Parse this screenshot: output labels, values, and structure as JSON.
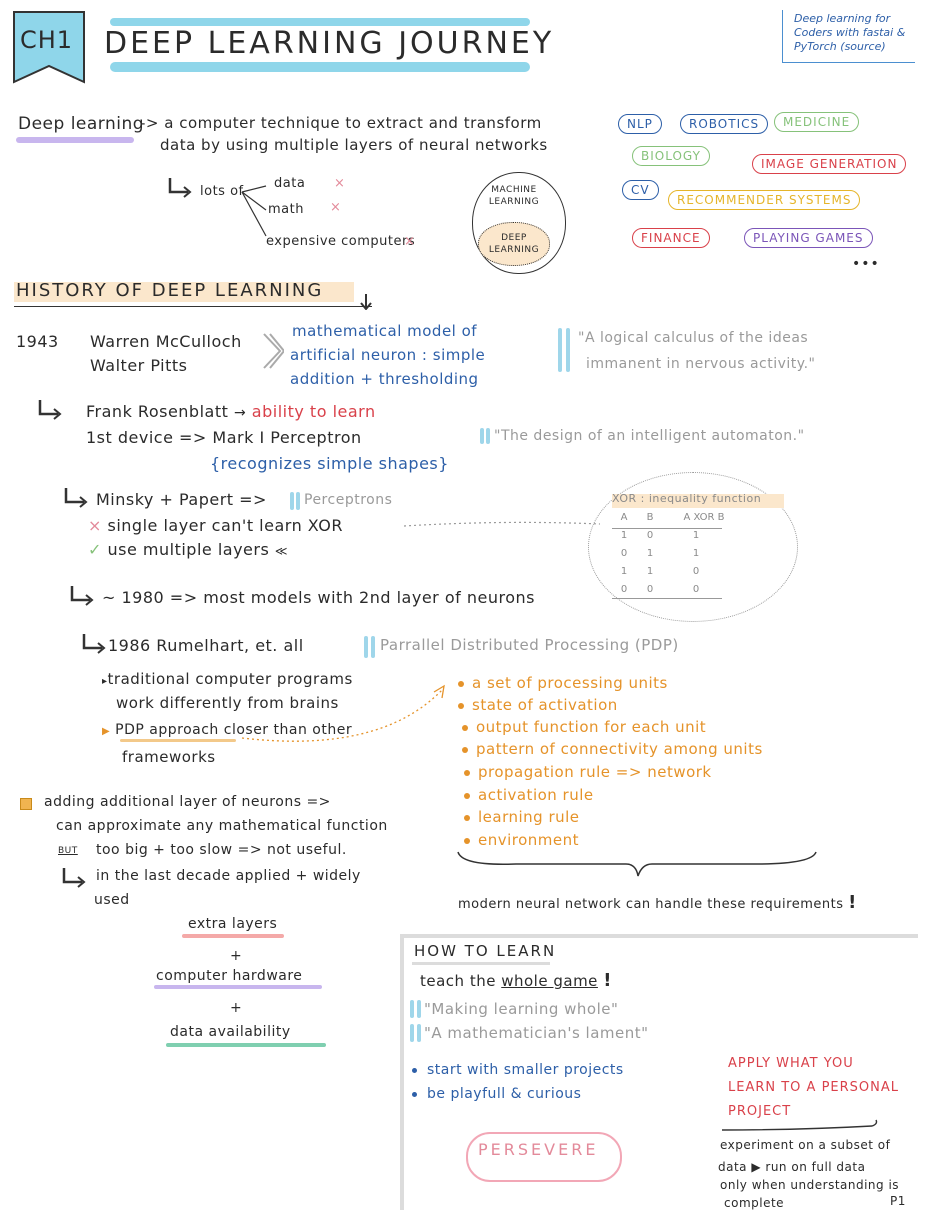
{
  "header": {
    "chapter": "CH1",
    "title": "DEEP LEARNING JOURNEY",
    "source": "Deep learning for Coders with fastai & PyTorch (source)"
  },
  "definition": {
    "term": "Deep learning",
    "arrow": "->",
    "line1": "a computer technique to extract and transform",
    "line2": "data by using multiple layers of neural networks",
    "lots_of": "lots of",
    "items": [
      "data",
      "math",
      "expensive computers"
    ],
    "x_mark": "×",
    "ml_label": "MACHINE LEARNING",
    "dl_label": "DEEP LEARNING"
  },
  "tags": [
    {
      "label": "NLP",
      "color": "#2d5fa8"
    },
    {
      "label": "ROBOTICS",
      "color": "#2d5fa8"
    },
    {
      "label": "MEDICINE",
      "color": "#86c27a"
    },
    {
      "label": "BIOLOGY",
      "color": "#86c27a"
    },
    {
      "label": "IMAGE GENERATION",
      "color": "#d9414a"
    },
    {
      "label": "CV",
      "color": "#2d5fa8"
    },
    {
      "label": "RECOMMENDER SYSTEMS",
      "color": "#e5b52a"
    },
    {
      "label": "FINANCE",
      "color": "#d9414a"
    },
    {
      "label": "PLAYING GAMES",
      "color": "#7b55b8"
    }
  ],
  "tags_more": "•••",
  "history": {
    "title": "HISTORY OF DEEP LEARNING",
    "y1943": "1943",
    "mcculloch": "Warren McCulloch",
    "pitts": "Walter Pitts",
    "model1": "mathematical model of",
    "model2": "artificial neuron : simple",
    "model3": "addition + thresholding",
    "quote1a": "\"A logical calculus of the ideas",
    "quote1b": "immanent in nervous activity.\"",
    "rosenblatt": "Frank Rosenblatt",
    "ability": "ability to learn",
    "first_device": "1st device => Mark I Perceptron",
    "recognizes": "{recognizes simple shapes}",
    "quote2": "\"The design of an intelligent automaton.\"",
    "minsky": "Minsky + Papert =>",
    "perceptrons": "Perceptrons",
    "single_layer": "single layer can't learn XOR",
    "multiple": "use multiple layers",
    "y1980": "~ 1980 => most models with 2nd layer of neurons",
    "y1986": "1986 Rumelhart, et. all",
    "pdp": "Parrallel Distributed Processing (PDP)",
    "traditional1": "traditional computer programs",
    "traditional2": "work differently from brains",
    "pdp_approach": "PDP approach",
    "closer": "closer than other",
    "frameworks": "frameworks"
  },
  "xor": {
    "title": "XOR : inequality function",
    "headers": [
      "A",
      "B",
      "A XOR B"
    ],
    "rows": [
      [
        "1",
        "0",
        "1"
      ],
      [
        "0",
        "1",
        "1"
      ],
      [
        "1",
        "1",
        "0"
      ],
      [
        "0",
        "0",
        "0"
      ]
    ]
  },
  "pdp_list": [
    "a set of processing units",
    "state of activation",
    "output function for each unit",
    "pattern of connectivity among units",
    "propagation rule => network",
    "activation rule",
    "learning rule",
    "environment"
  ],
  "requirements": "modern neural network can handle these requirements",
  "layers": {
    "line1": "adding additional layer of neurons =>",
    "line2": "can approximate any mathematical function",
    "but": "BUT",
    "line3": "too big + too slow => not useful.",
    "line4": "in the last decade applied + widely",
    "line5": "used",
    "extra": "extra layers",
    "plus": "+",
    "hardware": "computer hardware",
    "data": "data availability"
  },
  "how_to_learn": {
    "title": "HOW TO LEARN",
    "teach": "teach the",
    "whole_game": "whole game",
    "quote1": "\"Making learning whole\"",
    "quote2": "\"A mathematician's lament\"",
    "bullets": [
      "start with smaller projects",
      "be playfull & curious"
    ],
    "apply1": "APPLY WHAT YOU",
    "apply2": "LEARN TO A PERSONAL",
    "apply3": "PROJECT",
    "experiment1": "experiment on a subset of",
    "experiment2": "data ▶ run on full data",
    "experiment3": "only when understanding is",
    "experiment4": "complete",
    "persevere": "PERSEVERE",
    "page": "P1"
  }
}
